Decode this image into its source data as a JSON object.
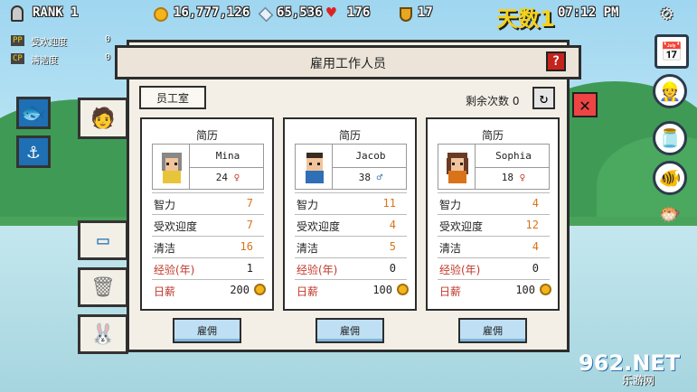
{
  "hud": {
    "rank_label": "RANK 1",
    "coins": "16,777,126",
    "gems": "65,536",
    "hearts": "176",
    "medals": "17",
    "day_label": "天数1",
    "time": "07:12 PM"
  },
  "stats": {
    "pp_tag": "PP",
    "pp_label": "受欢迎度",
    "pp_value": "0",
    "cp_tag": "CP",
    "cp_label": "清洁度",
    "cp_value": "0"
  },
  "dialog": {
    "title": "雇用工作人员",
    "help": "?",
    "staff_room_label": "员工室",
    "remaining_label": "剩余次数 0",
    "candidate_header": "简历",
    "labels": {
      "int": "智力",
      "popularity": "受欢迎度",
      "clean": "清洁",
      "experience": "经验(年)",
      "salary": "日薪"
    },
    "hire_label": "雇佣",
    "candidates": [
      {
        "name": "Mina",
        "age": "24",
        "gender": "♀",
        "int": "7",
        "popularity": "7",
        "clean": "16",
        "experience": "1",
        "salary": "200"
      },
      {
        "name": "Jacob",
        "age": "38",
        "gender": "♂",
        "int": "11",
        "popularity": "4",
        "clean": "5",
        "experience": "0",
        "salary": "100"
      },
      {
        "name": "Sophia",
        "age": "18",
        "gender": "♀",
        "int": "4",
        "popularity": "12",
        "clean": "4",
        "experience": "0",
        "salary": "100"
      }
    ]
  },
  "close_label": "✕",
  "watermark": "962.NET",
  "watermark_sub": "乐游网",
  "colors": {
    "accent_red": "#c0392b",
    "hire_blue": "#bfe0f4",
    "orange_value": "#d9731a"
  }
}
